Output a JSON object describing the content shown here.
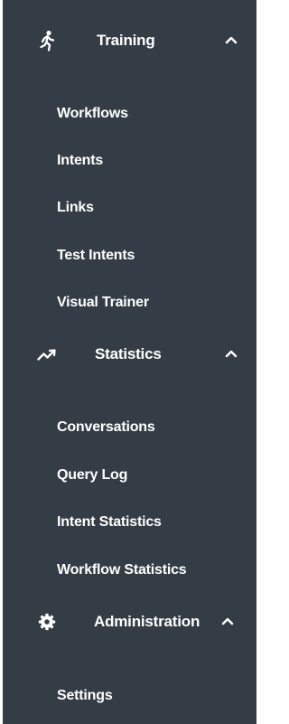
{
  "sidebar": {
    "sections": [
      {
        "label": "Training",
        "icon": "running-person-icon",
        "expanded": true,
        "items": [
          "Workflows",
          "Intents",
          "Links",
          "Test Intents",
          "Visual Trainer"
        ]
      },
      {
        "label": "Statistics",
        "icon": "trending-up-icon",
        "expanded": true,
        "items": [
          "Conversations",
          "Query Log",
          "Intent Statistics",
          "Workflow Statistics"
        ]
      },
      {
        "label": "Administration",
        "icon": "gear-icon",
        "expanded": true,
        "items": [
          "Settings"
        ]
      }
    ]
  },
  "colors": {
    "sidebar_bg": "#343d46",
    "text": "#ffffff"
  }
}
